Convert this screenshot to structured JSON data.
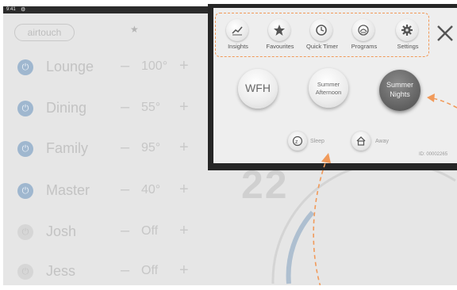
{
  "status_bar": {
    "time": "9:41",
    "left_icon": "gear-icon",
    "right_icon": "wifi-icon"
  },
  "app": {
    "logo": "airtouch",
    "favourite_icon": "star-icon"
  },
  "rooms": [
    {
      "name": "Lounge",
      "temp": "100°",
      "on": true
    },
    {
      "name": "Dining",
      "temp": "55°",
      "on": true
    },
    {
      "name": "Family",
      "temp": "95°",
      "on": true
    },
    {
      "name": "Master",
      "temp": "40°",
      "on": true
    },
    {
      "name": "Josh",
      "temp": "Off",
      "on": false
    },
    {
      "name": "Jess",
      "temp": "Off",
      "on": false
    }
  ],
  "background_temp": "22",
  "menu": {
    "tools": [
      {
        "label": "Insights",
        "icon": "chart-icon"
      },
      {
        "label": "Favourites",
        "icon": "star-icon"
      },
      {
        "label": "Quick Timer",
        "icon": "clock-icon"
      },
      {
        "label": "Programs",
        "icon": "programs-icon"
      },
      {
        "label": "Settings",
        "icon": "gear-icon"
      }
    ],
    "close_icon": "close-icon",
    "scenes": {
      "wfh": "WFH",
      "summer_afternoon_line1": "Summer",
      "summer_afternoon_line2": "Afternoon",
      "summer_nights_line1": "Summer",
      "summer_nights_line2": "Nights"
    },
    "sleep_label": "Sleep",
    "away_label": "Away",
    "device_id": "ID: 00002265"
  },
  "colors": {
    "annotation": "#f19a5a",
    "power_on": "#9fb7cf",
    "scene_active": "#666666"
  }
}
